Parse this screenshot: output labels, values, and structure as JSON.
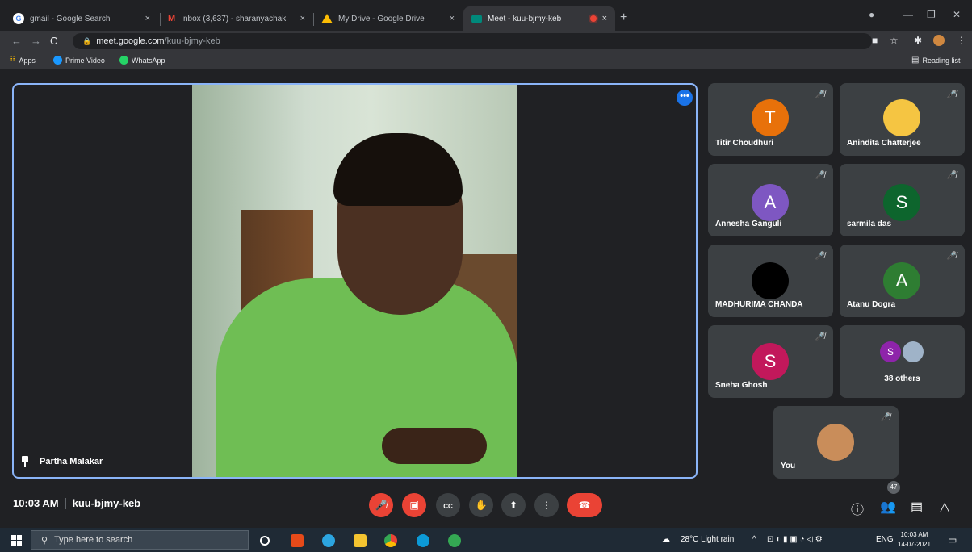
{
  "browser": {
    "tabs": [
      {
        "title": "gmail - Google Search",
        "favicon_color": "#4285f4"
      },
      {
        "title": "Inbox (3,637) - sharanyachakrab",
        "favicon_color": "#ea4335"
      },
      {
        "title": "My Drive - Google Drive",
        "favicon_color": "#fbbc04"
      },
      {
        "title": "Meet - kuu-bjmy-keb",
        "favicon_color": "#00897b"
      }
    ],
    "active_tab": 3,
    "tab_close": "×",
    "new_tab": "+",
    "url_domain": "meet.google.com",
    "url_path": "/kuu-bjmy-keb",
    "bookmarks": [
      "Apps",
      "Prime Video",
      "WhatsApp"
    ],
    "reading_list": "Reading list"
  },
  "meet": {
    "main_speaker": "Partha Malakar",
    "more_options": "•••",
    "participants": [
      {
        "name": "Titir Choudhuri",
        "initial": "T",
        "color": "#e8710a"
      },
      {
        "name": "Anindita Chatterjee",
        "initial": "",
        "color": "#f5c542"
      },
      {
        "name": "Annesha Ganguli",
        "initial": "A",
        "color": "#7e57c2"
      },
      {
        "name": "sarmila das",
        "initial": "S",
        "color": "#0d652d"
      },
      {
        "name": "MADHURIMA CHANDA",
        "initial": "",
        "color": "#000000"
      },
      {
        "name": "Atanu Dogra",
        "initial": "A",
        "color": "#2e7d32"
      },
      {
        "name": "Sneha Ghosh",
        "initial": "S",
        "color": "#c2185b"
      },
      {
        "name": "38 others",
        "initial": "S",
        "color": "#8e24aa"
      },
      {
        "name": "You",
        "initial": "",
        "color": "#c98d5a"
      }
    ],
    "time": "10:03 AM",
    "meeting_code": "kuu-bjmy-keb",
    "participant_count": "47"
  },
  "taskbar": {
    "search_placeholder": "Type here to search",
    "weather": "28°C  Light rain",
    "language": "ENG",
    "clock_time": "10:03 AM",
    "clock_date": "14-07-2021"
  }
}
